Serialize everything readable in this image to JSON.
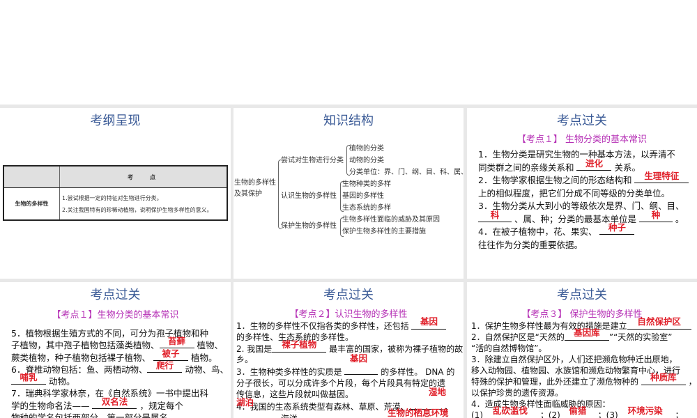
{
  "slides": [
    {
      "title": "考纲呈现",
      "table": {
        "header": [
          "",
          "考　点"
        ],
        "row_label": "生物的多样性",
        "row_items": [
          "1.尝试根据一定的特征对生物进行分类。",
          "2.关注我国特有的珍稀动植物，说明保护生物多样性的意义。"
        ]
      }
    },
    {
      "title": "知识结构",
      "tree": {
        "root": [
          "生物的多样性",
          "及其保护"
        ],
        "branches": [
          {
            "label": "尝试对生物进行分类",
            "items": [
              "植物的分类",
              "动物的分类",
              "分类单位：界、门、纲、目、科、属、种"
            ]
          },
          {
            "label": "认识生物的多样性",
            "items": [
              "生物种类的多样",
              "基因的多样性",
              "生态系统的多样"
            ]
          },
          {
            "label": "保护生物的多样性",
            "items": [
              "生物多样性面临的威胁及其原因",
              "保护生物多样性的主要措施"
            ]
          }
        ]
      }
    },
    {
      "title": "考点过关",
      "subtitle": "【考点１】 生物分类的基本常识",
      "lines": [
        [
          "1．生物分类是研究生物的一种基本方法，以弄清不"
        ],
        [
          "同类群之间的亲缘关系和 ",
          {
            "ans": "进化"
          },
          " 关系。"
        ],
        [
          "2．生物学家根据生物之间的形态结构和 ",
          {
            "ans": "生理特征"
          }
        ],
        [
          "上的相似程度，把它们分成不同等级的分类单位。"
        ],
        [
          "3．生物分类从大到小的等级依次是界、门、纲、目、"
        ],
        [
          {
            "ans": "科"
          },
          " 、属、种；分类的最基本单位是 ",
          {
            "ans": "种"
          },
          " 。"
        ],
        [
          "4．在被子植物中，花、果实、 ",
          {
            "ans": "种子"
          }
        ],
        [
          "往往作为分类的重要依据。"
        ]
      ]
    },
    {
      "title": "考点过关",
      "subtitle": "【考点１】生物分类的基本常识",
      "lines": [
        [
          "5．植物根据生殖方式的不同，可分为孢子植物和种"
        ],
        [
          "子植物，其中孢子植物包括藻类植物、",
          {
            "ans": "苔藓"
          },
          " 植物、"
        ],
        [
          "蕨类植物，种子植物包括裸子植物、 ",
          {
            "ans": "被子"
          },
          " 植物。"
        ],
        [
          "6．脊椎动物包括：鱼、两栖动物、",
          {
            "ans": "爬行"
          },
          " 动物、鸟、"
        ],
        [
          {
            "ans": "哺乳"
          },
          " 动物。"
        ],
        [
          "7．瑞典科学家林奈，在《自然系统》一书中提出科"
        ],
        [
          "学的生物命名法—— ",
          {
            "ans": "双名法"
          },
          " ，规定每个"
        ],
        [
          "物种的学名包括两部分，第一部分是属名"
        ]
      ]
    },
    {
      "title": "考点过关",
      "subtitle": "【考点２】认识生物的多样性",
      "lines": [
        [
          "1．生物的多样性不仅指各类的多样性，还包括 ",
          {
            "ans": "基因"
          }
        ],
        [
          "的多样性、生态系统的多样性。"
        ],
        [
          "2. 我国是",
          {
            "ans": "裸子植物"
          },
          " 最丰富的国家，被称为裸子植物的故"
        ],
        [
          "乡。"
        ],
        [
          "3．生物种类多样性的实质是 ",
          {
            "ans": ""
          },
          " 的多样性。 DNA 的"
        ],
        [
          "分子很长，可以分成许多个片段，每个片段具有特定的遗"
        ],
        [
          "传信息，这些片段就叫做基因。"
        ],
        [
          "4．我国的生态系统类型有森林、草原、荒漠、",
          {
            "ans": ""
          },
          " 、"
        ],
        [
          {
            "ans": ""
          },
          " 、海洋。"
        ]
      ],
      "floating": [
        "基因",
        "湿地",
        "湖泊",
        "生物的栖息环境"
      ]
    },
    {
      "title": "考点过关",
      "subtitle": "【考点３】 保护生物的多样性",
      "lines": [
        [
          "1．保护生物多样性最为有效的措施是建立",
          {
            "ans": "自然保护区"
          }
        ],
        [
          "2．自然保护区是“天然的",
          {
            "ans": "基因库"
          },
          "”“天然的实验室”"
        ],
        [
          "“活的自然博物馆”。"
        ],
        [
          "3．除建立自然保护区外，人们还把濒危物种迁出原地，"
        ],
        [
          "移入动物园、植物园、水族馆和濒危动物繁育中心，进行"
        ],
        [
          "特殊的保护和管理，此外还建立了濒危物种的 ",
          {
            "ans": "种质库"
          },
          " ，"
        ],
        [
          "以保护珍贵的遗传资源。"
        ],
        [
          " 4．造成生物多样性面临威胁的原因："
        ],
        [
          "(1)",
          {
            "ans": "乱砍滥伐"
          },
          " ；(2)",
          {
            "ans": "偷猎"
          },
          " ；(3)",
          {
            "ans": "环境污染"
          },
          " ；"
        ]
      ]
    }
  ],
  "colors": {
    "title": "#3a5a96",
    "subtitle": "#b52fb5",
    "answer": "#e0202a"
  }
}
